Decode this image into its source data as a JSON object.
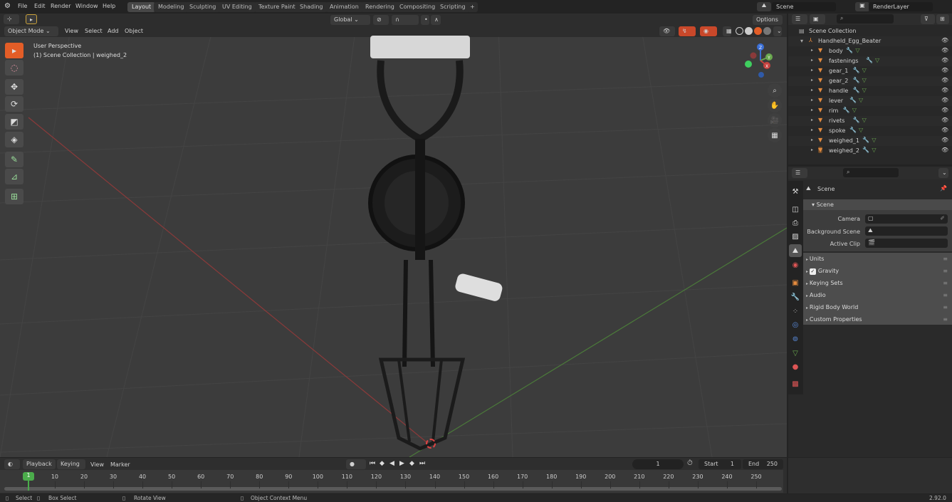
{
  "app": {
    "version": "2.92.0"
  },
  "menu": [
    "File",
    "Edit",
    "Render",
    "Window",
    "Help"
  ],
  "workspaces": [
    {
      "label": "Layout",
      "active": true
    },
    {
      "label": "Modeling"
    },
    {
      "label": "Sculpting"
    },
    {
      "label": "UV Editing"
    },
    {
      "label": "Texture Paint"
    },
    {
      "label": "Shading"
    },
    {
      "label": "Animation"
    },
    {
      "label": "Rendering"
    },
    {
      "label": "Compositing"
    },
    {
      "label": "Scripting"
    }
  ],
  "add_workspace": "+",
  "scene_selector": {
    "value": "Scene"
  },
  "renderlayer_selector": {
    "value": "RenderLayer"
  },
  "viewport_header": {
    "mode": "Object Mode",
    "menus": [
      "View",
      "Select",
      "Add",
      "Object"
    ],
    "orientation": "Global",
    "options_label": "Options"
  },
  "viewport": {
    "info_line1": "User Perspective",
    "info_line2": "(1) Scene Collection | weighed_2",
    "gizmo": {
      "x": "X",
      "y": "Y",
      "z": "Z"
    }
  },
  "toolbar": [
    "select-box",
    "cursor",
    "move",
    "rotate",
    "scale",
    "transform",
    "annotate",
    "measure",
    "add-cube"
  ],
  "outliner": {
    "root": "Scene Collection",
    "collection": "Handheld_Egg_Beater",
    "objects": [
      "body",
      "fastenings",
      "gear_1",
      "gear_2",
      "handle",
      "lever",
      "rim",
      "rivets",
      "spoke",
      "weighed_1",
      "weighed_2"
    ],
    "selected": "weighed_2"
  },
  "properties": {
    "context_title": "Scene",
    "panel_title": "Scene",
    "fields": [
      {
        "label": "Camera",
        "value": ""
      },
      {
        "label": "Background Scene",
        "value": ""
      },
      {
        "label": "Active Clip",
        "value": ""
      }
    ],
    "subpanels": [
      {
        "label": "Units"
      },
      {
        "label": "Gravity",
        "checkbox": true,
        "checked": true
      },
      {
        "label": "Keying Sets"
      },
      {
        "label": "Audio"
      },
      {
        "label": "Rigid Body World"
      },
      {
        "label": "Custom Properties"
      }
    ]
  },
  "timeline": {
    "menus": [
      "Playback",
      "Keying",
      "View",
      "Marker"
    ],
    "current_frame": "1",
    "start_label": "Start",
    "start": "1",
    "end_label": "End",
    "end": "250",
    "ticks": [
      "10",
      "20",
      "30",
      "40",
      "50",
      "60",
      "70",
      "80",
      "90",
      "100",
      "110",
      "120",
      "130",
      "140",
      "150",
      "160",
      "170",
      "180",
      "190",
      "200",
      "210",
      "220",
      "230",
      "240",
      "250"
    ],
    "playhead": "1"
  },
  "statusbar": [
    {
      "label": "Select"
    },
    {
      "label": "Box Select"
    },
    {
      "label": "Rotate View"
    },
    {
      "label": "Object Context Menu"
    }
  ],
  "colors": {
    "accent": "#e35d27",
    "active_frame": "#4bac4b",
    "axis_x": "#c8423f",
    "axis_y": "#6aa84f",
    "axis_z": "#3b6fd6"
  }
}
